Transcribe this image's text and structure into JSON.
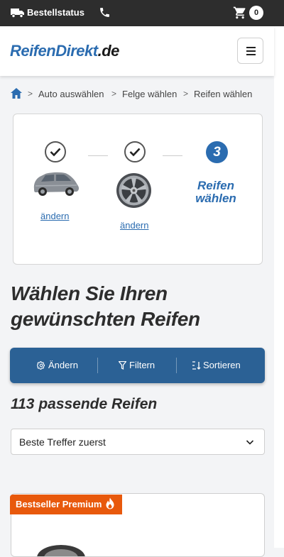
{
  "topbar": {
    "status_label": "Bestellstatus",
    "cart_count": "0"
  },
  "header": {
    "logo_part1": "ReifenDirekt",
    "logo_part2": ".de"
  },
  "breadcrumb": {
    "items": [
      "Auto auswählen",
      "Felge wählen",
      "Reifen wählen"
    ],
    "separator": ">"
  },
  "steps": {
    "step1_link": "ändern",
    "step2_link": "ändern",
    "step3_number": "3",
    "step3_label_line1": "Reifen",
    "step3_label_line2": "wählen"
  },
  "main": {
    "heading_line1": "Wählen Sie Ihren",
    "heading_line2": "gewünschten Reifen",
    "result_count": "113 passende Reifen"
  },
  "actions": {
    "change_label": "Ändern",
    "filter_label": "Filtern",
    "sort_label": "Sortieren"
  },
  "sort": {
    "selected": "Beste Treffer zuerst"
  },
  "product": {
    "badge_label": "Bestseller Premium"
  },
  "colors": {
    "brand_blue": "#2b6cb0",
    "action_bar": "#2b6195",
    "badge_orange": "#e8590c",
    "topbar": "#2d2d2d"
  }
}
